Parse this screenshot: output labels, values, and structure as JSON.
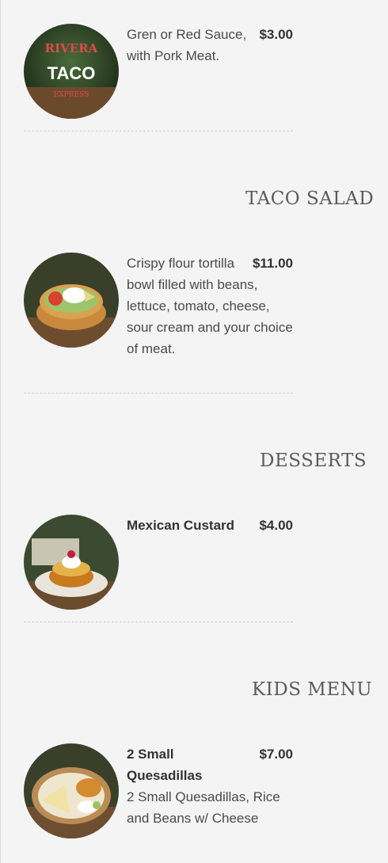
{
  "sections": {
    "taco_salad": "TACO SALAD",
    "desserts": "DESSERTS",
    "kids_menu": "KIDS MENU"
  },
  "items": {
    "pork": {
      "description": "Gren or Red Sauce, with Pork Meat.",
      "price": "$3.00",
      "logo_line1": "RIVERA",
      "logo_line2": "TACO",
      "logo_line3": "EXPRESS"
    },
    "taco_salad": {
      "description": "Crispy flour tortilla bowl filled with beans, lettuce, tomato, cheese, sour cream and your choice of meat.",
      "price": "$11.00"
    },
    "custard": {
      "title": "Mexican Custard",
      "price": "$4.00"
    },
    "quesadillas": {
      "title": "2 Small Quesadillas",
      "description": "2 Small Quesadillas, Rice and Beans w/ Cheese",
      "price": "$7.00"
    }
  },
  "colors": {
    "background": "#f4f4f4",
    "text": "#4a4a4a",
    "heading": "#5b5b5b",
    "divider": "#cfcfcf"
  }
}
